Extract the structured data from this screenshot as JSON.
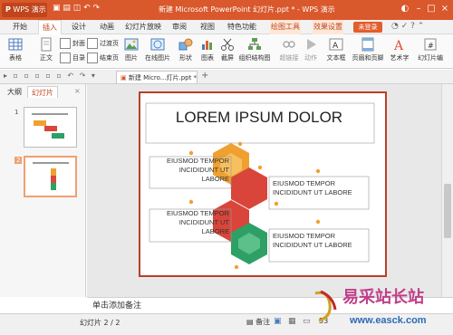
{
  "app": {
    "name": "WPS 演示",
    "title": "新建 Microsoft PowerPoint 幻灯片.ppt * - WPS 演示"
  },
  "menu": {
    "items": [
      "开始",
      "插入",
      "设计",
      "动画",
      "幻灯片放映",
      "审阅",
      "视图",
      "特色功能",
      "绘图工具",
      "效果设置"
    ],
    "active": "插入",
    "login": "未登录"
  },
  "ribbon": {
    "table": "表格",
    "text_btn": "正文",
    "cover": "封面",
    "toc": "目录",
    "transition": "过渡页",
    "ending": "结束页",
    "picture": "图片",
    "online_picture": "在线图片",
    "shapes": "形状",
    "chart": "图表",
    "screenshot": "截屏",
    "smartart": "组织结构图",
    "hyperlink": "超链接",
    "action": "动作",
    "textbox": "文本框",
    "header_footer": "页眉和页脚",
    "wordart": "艺术字",
    "slide_number": "幻灯片编"
  },
  "doc_tab": "新建 Micro...灯片.ppt *",
  "panel": {
    "tab_outline": "大纲",
    "tab_slides": "幻灯片",
    "slides": [
      "1",
      "2"
    ]
  },
  "slide": {
    "title": "LOREM IPSUM DOLOR",
    "items": [
      "EIUSMOD TEMPOR INCIDIDUNT UT LABORE",
      "EIUSMOD TEMPOR INCIDIDUNT UT LABORE",
      "EIUSMOD TEMPOR INCIDIDUNT UT LABORE",
      "EIUSMOD TEMPOR INCIDIDUNT UT LABORE"
    ]
  },
  "notes_placeholder": "单击添加备注",
  "status": {
    "slide_count": "幻灯片 2 / 2",
    "notes": "备注",
    "zoom": "53"
  },
  "watermark": {
    "text": "易采站长站",
    "url": "www.easck.com"
  },
  "colors": {
    "titlebar": "#d9582c",
    "accent": "#c0451d",
    "orange": "#f0a030",
    "red": "#d9453a",
    "green": "#2ea066"
  }
}
